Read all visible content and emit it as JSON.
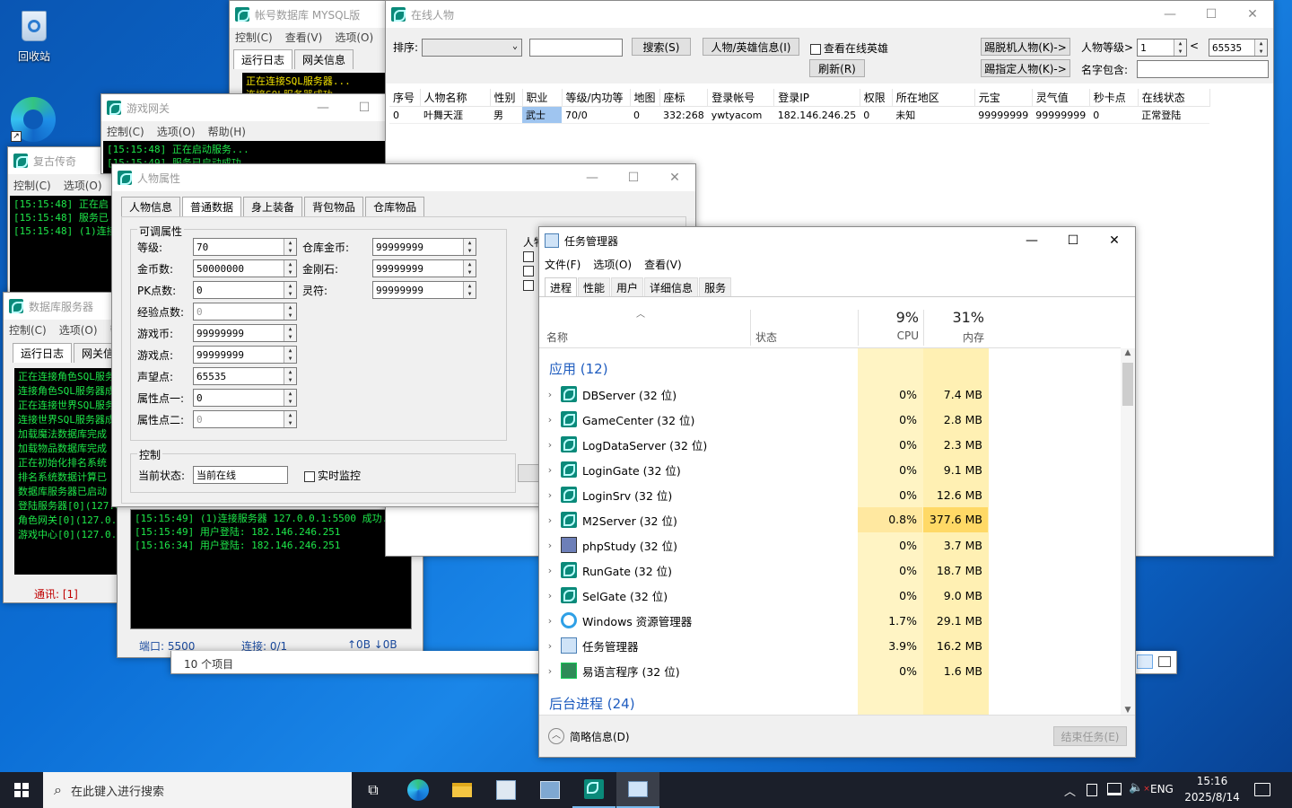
{
  "desktop": {
    "recycle_bin": "回收站"
  },
  "acct_db": {
    "title": "帐号数据库 MYSQL版",
    "menu": [
      "控制(C)",
      "查看(V)",
      "选项(O)"
    ],
    "tabs": [
      "运行日志",
      "网关信息"
    ],
    "log": [
      "正在连接SQL服务器...",
      "连接SQL服务器成功"
    ]
  },
  "gate": {
    "title": "游戏网关",
    "menu": [
      "控制(C)",
      "选项(O)",
      "帮助(H)"
    ],
    "log": [
      "[15:15:48] 正在启动服务...",
      "[15:15:49] 服务已启动成功..."
    ]
  },
  "fugu": {
    "title": "复古传奇",
    "menu": [
      "控制(C)",
      "选项(O)"
    ],
    "log": [
      "[15:15:48] 正在启",
      "[15:15:48] 服务已",
      "[15:15:48] (1)连接"
    ]
  },
  "dbsvr": {
    "title": "数据库服务器",
    "menu": [
      "控制(C)",
      "选项(O)",
      "帮"
    ],
    "tabs": [
      "运行日志",
      "网关信"
    ],
    "log": [
      "正在连接角色SQL服务",
      "连接角色SQL服务器成",
      "正在连接世界SQL服务",
      "连接世界SQL服务器成",
      "加载魔法数据库完成",
      "加载物品数据库完成",
      "正在初始化排名系统",
      "排名系统数据计算已",
      "数据库服务器已启动",
      "登陆服务器[0](127.0",
      "角色网关[0](127.0.0",
      "游戏中心[0](127.0.0"
    ],
    "status": "通讯: [1]"
  },
  "gate_log2": {
    "log": [
      "[15:15:49] (1)连接服务器 127.0.0.1:5500 成功.",
      "[15:15:49] 用户登陆: 182.146.246.251",
      "[15:16:34] 用户登陆: 182.146.246.251"
    ],
    "port": "端口: 5500",
    "conn": "连接: 0/1",
    "io": "↑0B  ↓0B"
  },
  "items_count": "10 个项目",
  "online": {
    "title": "在线人物",
    "sort_label": "排序:",
    "search_btn": "搜索(S)",
    "info_btn": "人物/英雄信息(I)",
    "hero_chk": "查看在线英雄",
    "refresh_btn": "刷新(R)",
    "kick_offline": "踢脱机人物(K)->",
    "kick_sel": "踢指定人物(K)->",
    "level_label": "人物等级>",
    "lv_min": "1",
    "lt": "<",
    "lv_max": "65535",
    "name_label": "名字包含:",
    "headers": [
      "序号",
      "人物名称",
      "性别",
      "职业",
      "等级/内功等",
      "地图",
      "座标",
      "登录帐号",
      "登录IP",
      "权限",
      "所在地区",
      "元宝",
      "灵气值",
      "秒卡点",
      "在线状态"
    ],
    "row": [
      "0",
      "叶舞天涯",
      "男",
      "武士",
      "70/0",
      "0",
      "332:268",
      "ywtyacom",
      "182.146.246.25",
      "0",
      "未知",
      "99999999",
      "99999999",
      "0",
      "正常登陆"
    ]
  },
  "attr": {
    "title": "人物属性",
    "tabs": [
      "人物信息",
      "普通数据",
      "身上装备",
      "背包物品",
      "仓库物品"
    ],
    "group": "可调属性",
    "fields": [
      {
        "label": "等级:",
        "value": "70"
      },
      {
        "label": "金币数:",
        "value": "50000000"
      },
      {
        "label": "PK点数:",
        "value": "0"
      },
      {
        "label": "经验点数:",
        "value": "0"
      },
      {
        "label": "游戏币:",
        "value": "99999999"
      },
      {
        "label": "游戏点:",
        "value": "99999999"
      },
      {
        "label": "声望点:",
        "value": "65535"
      },
      {
        "label": "属性点一:",
        "value": "0"
      },
      {
        "label": "属性点二:",
        "value": "0"
      }
    ],
    "fields2": [
      {
        "label": "仓库金币:",
        "value": "99999999"
      },
      {
        "label": "金刚石:",
        "value": "99999999"
      },
      {
        "label": "灵符:",
        "value": "99999999"
      }
    ],
    "ctrl_group": "控制",
    "state_label": "当前状态:",
    "state_value": "当前在线",
    "monitor": "实时监控",
    "side_label": "人物"
  },
  "tm": {
    "title": "任务管理器",
    "menu": [
      "文件(F)",
      "选项(O)",
      "查看(V)"
    ],
    "tabs": [
      "进程",
      "性能",
      "用户",
      "详细信息",
      "服务"
    ],
    "col_name": "名称",
    "col_status": "状态",
    "cpu_pct": "9%",
    "cpu_label": "CPU",
    "mem_pct": "31%",
    "mem_label": "内存",
    "apps_group": "应用 (12)",
    "bg_group": "后台进程 (24)",
    "less": "简略信息(D)",
    "end_task": "结束任务(E)",
    "procs": [
      {
        "name": "DBServer (32 位)",
        "cpu": "0%",
        "mem": "7.4 MB",
        "icon": "game-icon"
      },
      {
        "name": "GameCenter (32 位)",
        "cpu": "0%",
        "mem": "2.8 MB",
        "icon": "game-icon"
      },
      {
        "name": "LogDataServer (32 位)",
        "cpu": "0%",
        "mem": "2.3 MB",
        "icon": "game-icon"
      },
      {
        "name": "LoginGate (32 位)",
        "cpu": "0%",
        "mem": "9.1 MB",
        "icon": "game-icon"
      },
      {
        "name": "LoginSrv (32 位)",
        "cpu": "0%",
        "mem": "12.6 MB",
        "icon": "game-icon"
      },
      {
        "name": "M2Server (32 位)",
        "cpu": "0.8%",
        "mem": "377.6 MB",
        "icon": "game-icon"
      },
      {
        "name": "phpStudy (32 位)",
        "cpu": "0%",
        "mem": "3.7 MB",
        "icon": "php-icon"
      },
      {
        "name": "RunGate (32 位)",
        "cpu": "0%",
        "mem": "18.7 MB",
        "icon": "game-icon"
      },
      {
        "name": "SelGate (32 位)",
        "cpu": "0%",
        "mem": "9.0 MB",
        "icon": "game-icon"
      },
      {
        "name": "Windows 资源管理器",
        "cpu": "1.7%",
        "mem": "29.1 MB",
        "icon": "explorer-icon"
      },
      {
        "name": "任务管理器",
        "cpu": "3.9%",
        "mem": "16.2 MB",
        "icon": "taskmgr-icon"
      },
      {
        "name": "易语言程序 (32 位)",
        "cpu": "0%",
        "mem": "1.6 MB",
        "icon": "easy-icon"
      }
    ]
  },
  "taskbar": {
    "search": "在此键入进行搜索",
    "lang": "ENG",
    "time": "15:16",
    "date": "2025/8/14"
  }
}
